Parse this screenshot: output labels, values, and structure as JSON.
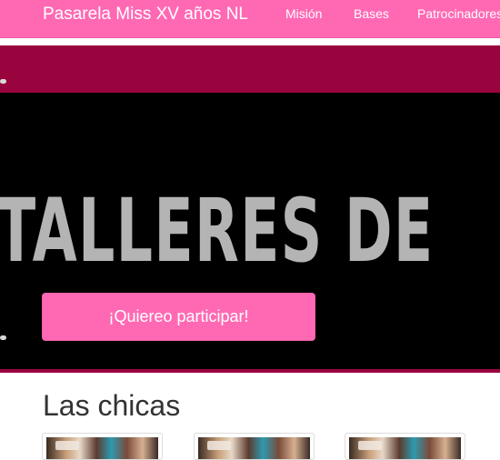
{
  "navbar": {
    "brand": "Pasarela Miss XV años NL",
    "links": [
      {
        "label": "Misión"
      },
      {
        "label": "Bases"
      },
      {
        "label": "Patrocinadores"
      }
    ]
  },
  "hero": {
    "slide_text": "TALLERES DE",
    "cta_label": "¡Quiereo participar!"
  },
  "section": {
    "title": "Las chicas"
  },
  "colors": {
    "navbar": "#ff69b4",
    "hero_background": "#99043f",
    "slide_background": "#000000",
    "slide_text": "#b4b4b4",
    "cta": "#ff69b4"
  }
}
